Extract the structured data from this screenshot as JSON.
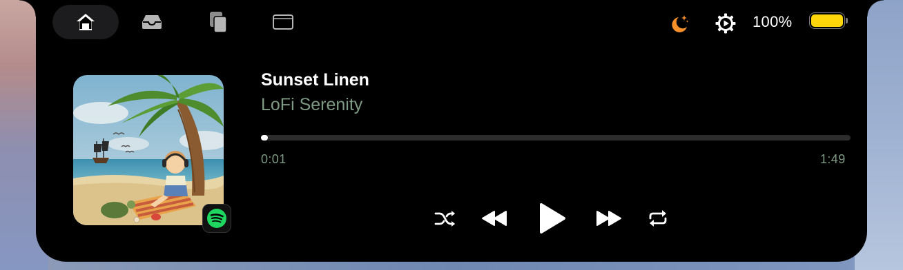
{
  "top_bar": {
    "tabs": [
      {
        "icon": "home-icon",
        "active": true
      },
      {
        "icon": "tray-icon",
        "active": false
      },
      {
        "icon": "documents-icon",
        "active": false
      },
      {
        "icon": "window-icon",
        "active": false
      }
    ],
    "status": {
      "moon_icon": "moon-stars-icon",
      "moon_color": "#f7902a",
      "settings_icon": "gear-play-icon",
      "battery_percent": "100%",
      "battery_level": 1.0,
      "battery_color": "#ffd60a"
    }
  },
  "now_playing": {
    "title": "Sunset Linen",
    "artist": "LoFi Serenity",
    "app_badge_icon": "spotify-icon",
    "app_color": "#1ed760",
    "elapsed": "0:01",
    "duration": "1:49",
    "progress": 0.01,
    "controls": [
      {
        "name": "shuffle-button",
        "icon": "shuffle-icon"
      },
      {
        "name": "previous-button",
        "icon": "rewind-icon"
      },
      {
        "name": "play-button",
        "icon": "play-icon"
      },
      {
        "name": "next-button",
        "icon": "fast-forward-icon"
      },
      {
        "name": "repeat-button",
        "icon": "repeat-icon"
      }
    ]
  },
  "colors": {
    "panel": "#000000",
    "artist_text": "#7f9a84",
    "progress_track": "#2c2c2e"
  }
}
